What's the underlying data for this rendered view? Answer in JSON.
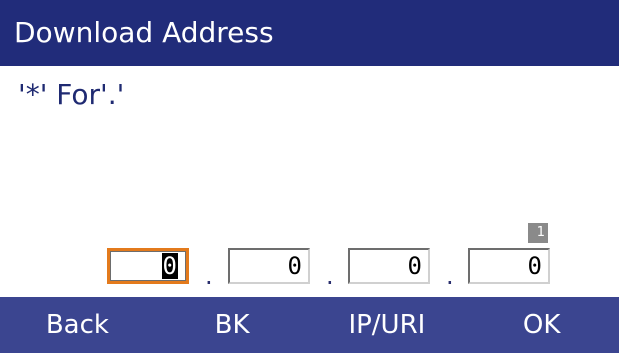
{
  "header": {
    "title": "Download Address"
  },
  "hint": "'*' For'.'",
  "page_indicator": "1",
  "address": {
    "octets": [
      "0",
      "0",
      "0",
      "0"
    ],
    "separator": "."
  },
  "softkeys": [
    {
      "label": "Back"
    },
    {
      "label": "BK"
    },
    {
      "label": "IP/URI"
    },
    {
      "label": "OK"
    }
  ],
  "colors": {
    "title_bar": "#212c7a",
    "softkey_bar": "#3b4590",
    "focus_border": "#e37a1c",
    "text_dark_blue": "#1f2a72"
  }
}
